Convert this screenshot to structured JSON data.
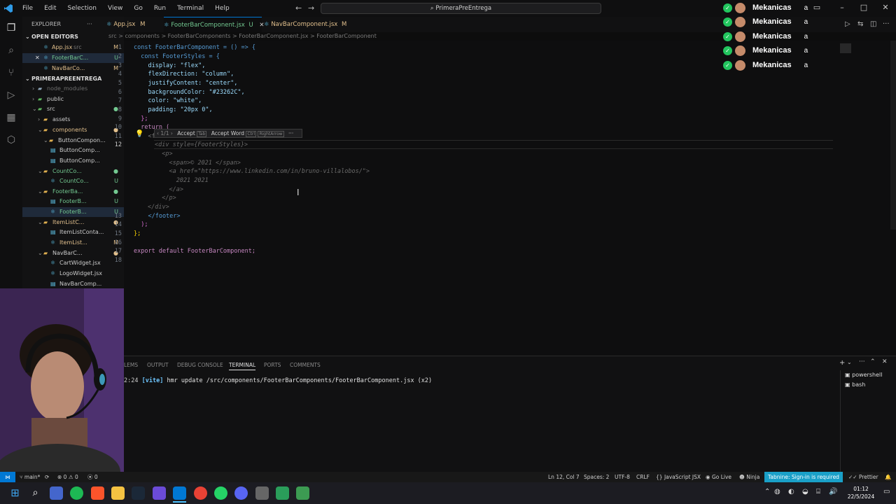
{
  "titlebar": {
    "menu": [
      "File",
      "Edit",
      "Selection",
      "View",
      "Go",
      "Run",
      "Terminal",
      "Help"
    ],
    "search_text": "PrimeraPreEntrega"
  },
  "sidebar": {
    "explorer_title": "EXPLORER",
    "open_editors_title": "OPEN EDITORS",
    "open_editors": [
      {
        "name": "App.jsx",
        "path": "src",
        "badge": "M"
      },
      {
        "name": "FooterBarC...",
        "path": "",
        "badge": "U"
      },
      {
        "name": "NavBarCo...",
        "path": "",
        "badge": "M"
      }
    ],
    "project_title": "PRIMERAPREENTREGA",
    "tree": [
      {
        "name": "node_modules",
        "badge": ""
      },
      {
        "name": "public",
        "badge": ""
      },
      {
        "name": "src",
        "badge": ""
      },
      {
        "name": "assets",
        "badge": ""
      },
      {
        "name": "components",
        "badge": ""
      },
      {
        "name": "ButtonCompon...",
        "badge": ""
      },
      {
        "name": "ButtonComp...",
        "badge": ""
      },
      {
        "name": "ButtonComp...",
        "badge": ""
      },
      {
        "name": "CountCo...",
        "badge": ""
      },
      {
        "name": "CountCo...",
        "badge": "U"
      },
      {
        "name": "FooterBa...",
        "badge": ""
      },
      {
        "name": "FooterB...",
        "badge": "U"
      },
      {
        "name": "FooterB...",
        "badge": "U"
      },
      {
        "name": "ItemListC...",
        "badge": ""
      },
      {
        "name": "ItemListConta...",
        "badge": ""
      },
      {
        "name": "ItemList...",
        "badge": "M"
      },
      {
        "name": "NavBarC...",
        "badge": ""
      },
      {
        "name": "CartWidget.jsx",
        "badge": ""
      },
      {
        "name": "LogoWidget.jsx",
        "badge": ""
      },
      {
        "name": "NavBarComp...",
        "badge": ""
      }
    ]
  },
  "tabs": [
    {
      "label": "App.jsx",
      "badge": "M"
    },
    {
      "label": "FooterBarComponent.jsx",
      "badge": "U"
    },
    {
      "label": "NavBarComponent.jsx",
      "badge": "M"
    }
  ],
  "breadcrumb": "src > components > FooterBarComponents > FooterBarComponent.jsx > FooterBarComponent",
  "editor": {
    "line_numbers": [
      "1",
      "2",
      "3",
      "4",
      "5",
      "6",
      "7",
      "8",
      "9",
      "10",
      "11",
      "12",
      "13",
      "14",
      "15",
      "16",
      "17",
      "18"
    ],
    "lines": [
      "const FooterBarComponent = () => {",
      "  const FooterStyles = {",
      "    display: \"flex\",",
      "    flexDirection: \"column\",",
      "    justifyContent: \"center\",",
      "    backgroundColor: \"#23262C\",",
      "    color: \"white\",",
      "    padding: \"20px 0\",",
      "  };",
      "  return (",
      "    <f",
      "",
      "    </footer>",
      "  );",
      "};",
      "",
      "export default FooterBarComponent;",
      ""
    ],
    "ghost_lines": [
      "<div style={FooterStyles}>",
      "  <p>",
      "    <span>© 2021 </span>",
      "    <a href=\"https://www.linkedin.com/in/bruno-villalobos/\">",
      "      2021 2021",
      "    </a>",
      "  </p>",
      "</div>"
    ],
    "inline_widget": {
      "counter": "1/1",
      "accept": "Accept",
      "accept_key": "Tab",
      "accept_word": "Accept Word",
      "accept_word_key1": "Ctrl",
      "accept_word_key2": "RightArrow",
      "more": "···"
    }
  },
  "panel": {
    "tabs": [
      "LEMS",
      "OUTPUT",
      "DEBUG CONSOLE",
      "TERMINAL",
      "PORTS",
      "COMMENTS"
    ],
    "active_tab": "TERMINAL",
    "terminal_line_prefix": "2:24",
    "terminal_line_tag": "[vite]",
    "terminal_line_rest": "hmr update /src/components/FooterBarComponents/FooterBarComponent.jsx (x2)",
    "shells": [
      "powershell",
      "bash"
    ]
  },
  "overlay": {
    "rows": [
      {
        "name": "Mekanicas",
        "value": "a"
      },
      {
        "name": "Mekanicas",
        "value": "a"
      },
      {
        "name": "Mekanicas",
        "value": "a"
      },
      {
        "name": "Mekanicas",
        "value": "a"
      },
      {
        "name": "Mekanicas",
        "value": "a"
      }
    ]
  },
  "statusbar": {
    "branch": "main*",
    "errors": "0",
    "warnings": "0",
    "ports": "0",
    "position": "Ln 12, Col 7",
    "spaces": "Spaces: 2",
    "encoding": "UTF-8",
    "eol": "CRLF",
    "language": "JavaScript JSX",
    "golive": "Go Live",
    "ninja": "Ninja",
    "tabnine": "Tabnine: Sign-in is required",
    "prettier": "Prettier"
  },
  "taskbar": {
    "time": "01:12",
    "date": "22/5/2024"
  },
  "colors": {
    "accent": "#0078d4",
    "tabnine_bg": "#1aa0c8",
    "check_green": "#22c55e"
  }
}
